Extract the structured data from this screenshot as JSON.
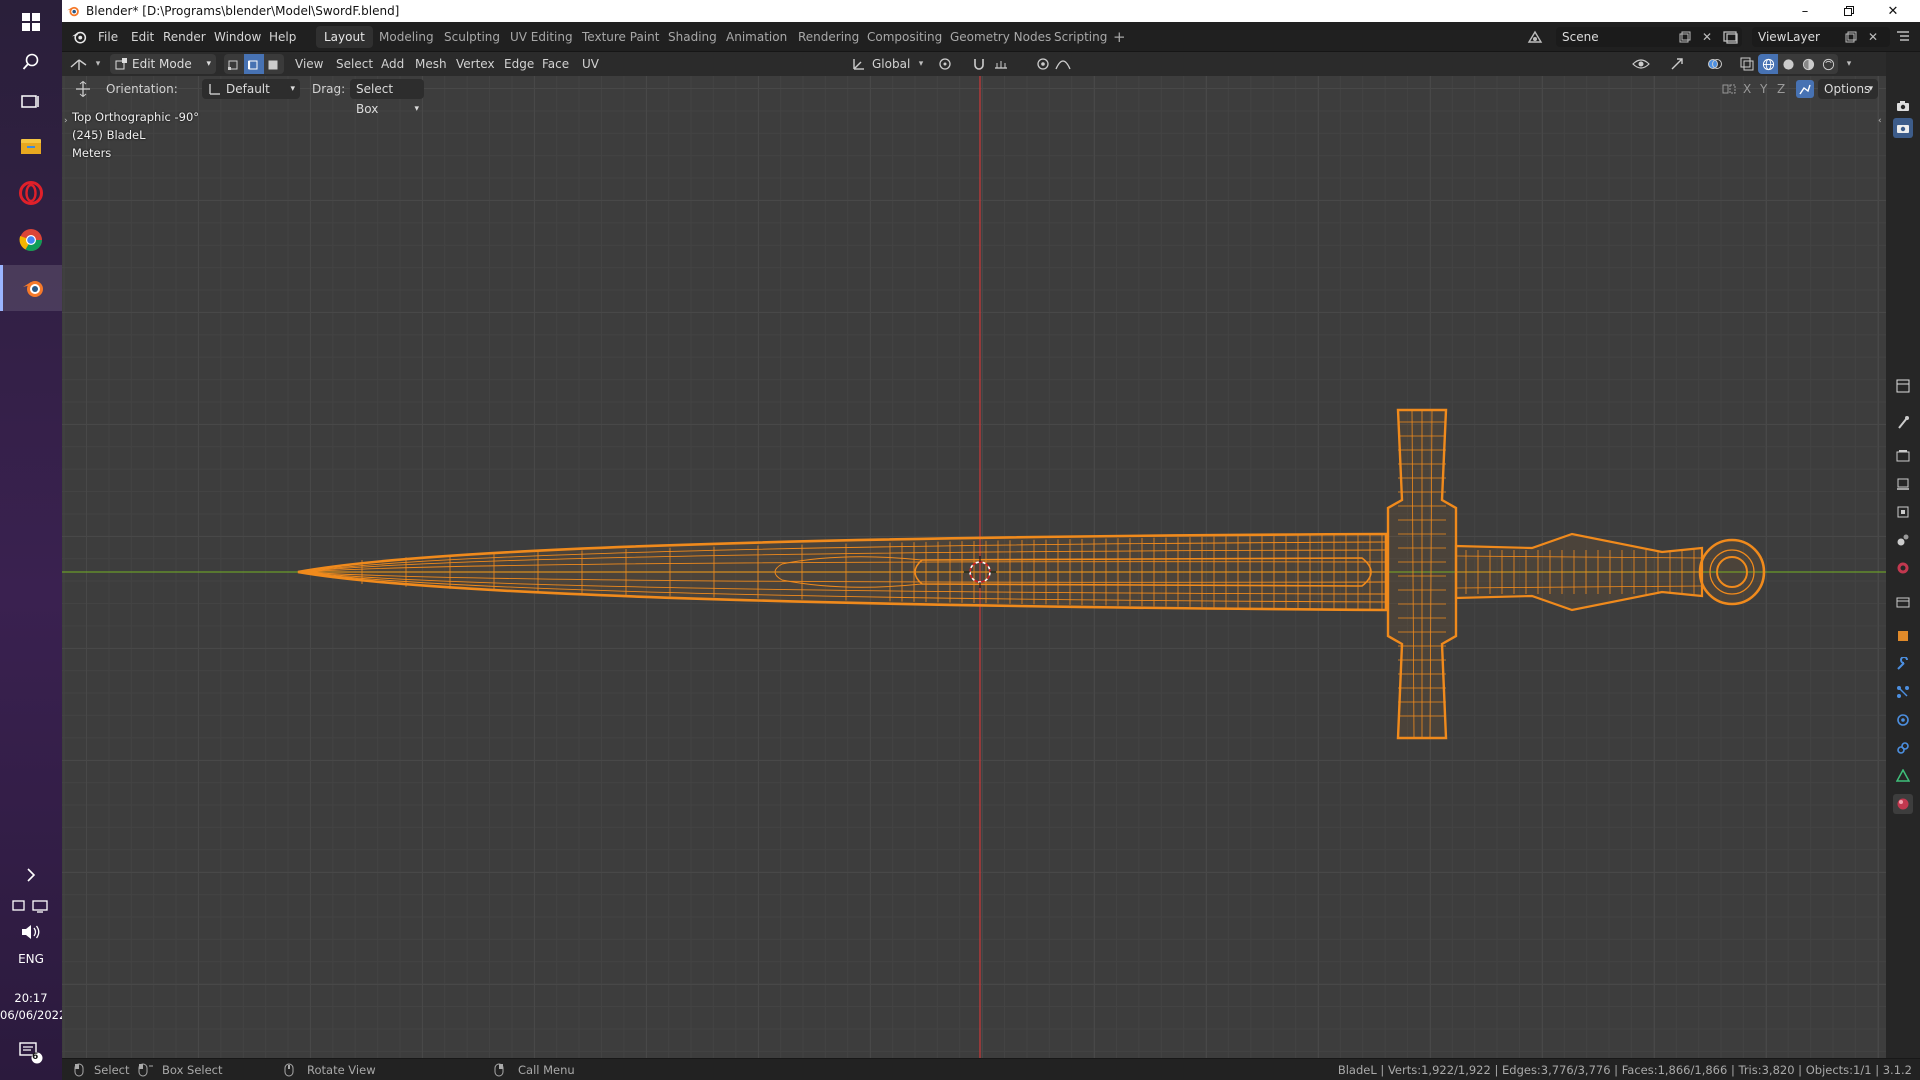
{
  "window": {
    "title": "Blender* [D:\\Programs\\blender\\Model\\SwordF.blend]"
  },
  "taskbar": {
    "language": "ENG",
    "time": "20:17",
    "date": "06/06/2022",
    "notification_count": "6"
  },
  "menus": [
    "File",
    "Edit",
    "Render",
    "Window",
    "Help"
  ],
  "workspaces": [
    "Layout",
    "Modeling",
    "Sculpting",
    "UV Editing",
    "Texture Paint",
    "Shading",
    "Animation",
    "Rendering",
    "Compositing",
    "Geometry Nodes",
    "Scripting"
  ],
  "active_workspace": "Layout",
  "scene": {
    "name": "Scene",
    "view_layer": "ViewLayer"
  },
  "header": {
    "mode": "Edit Mode",
    "menus": [
      "View",
      "Select",
      "Add",
      "Mesh",
      "Vertex",
      "Edge",
      "Face",
      "UV"
    ],
    "transform_orientation": "Global"
  },
  "tool_settings": {
    "orientation_label": "Orientation:",
    "orientation_value": "Default",
    "drag_label": "Drag:",
    "drag_value": "Select Box",
    "axis_x": "X",
    "axis_y": "Y",
    "axis_z": "Z",
    "options_label": "Options"
  },
  "viewport": {
    "view_name": "Top Orthographic -90°",
    "object_info": "(245) BladeL",
    "units": "Meters"
  },
  "statusbar": {
    "hint_select": "Select",
    "hint_box_select": "Box Select",
    "hint_rotate": "Rotate View",
    "hint_menu": "Call Menu",
    "stats": "BladeL | Verts:1,922/1,922 | Edges:3,776/3,776 | Faces:1,866/1,866 | Tris:3,820 | Objects:1/1 | 3.1.2"
  },
  "colors": {
    "accent_orange": "#f08a1c",
    "x_axis_red": "#c23a3a",
    "y_axis_green": "#6a9a2a",
    "active_tab_blue": "#4772b3"
  }
}
